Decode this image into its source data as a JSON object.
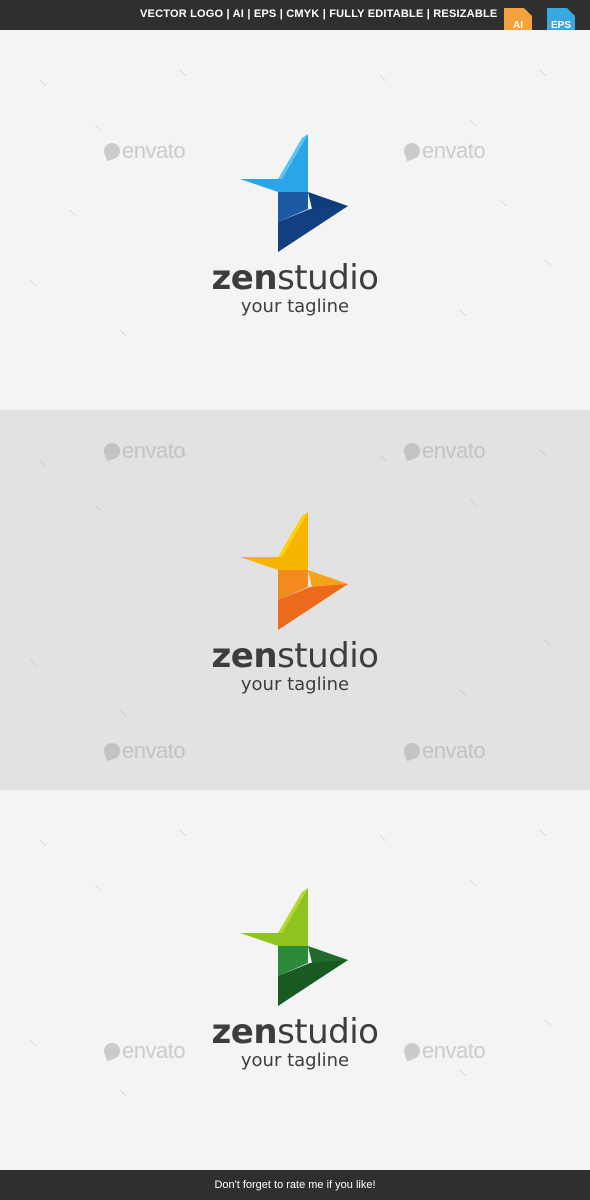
{
  "header": {
    "features": "VECTOR LOGO  |  AI  |  EPS  | CMYK  |  FULLY EDITABLE  |  RESIZABLE",
    "badges": {
      "ai": "AI",
      "eps": "EPS"
    },
    "badge_colors": {
      "ai": "#f4a23c",
      "eps": "#38a9e0"
    }
  },
  "watermark_text": "envato",
  "logos": [
    {
      "brand_bold": "zen",
      "brand_regular": "studio",
      "tagline": "your tagline",
      "colors": {
        "top": "#2aa6e8",
        "top_light": "#5cc3f2",
        "bottom": "#0d3c7a",
        "bottom_light": "#1d5aa6"
      }
    },
    {
      "brand_bold": "zen",
      "brand_regular": "studio",
      "tagline": "your tagline",
      "colors": {
        "top": "#f7b500",
        "top_light": "#fcd200",
        "bottom": "#ec6a1c",
        "bottom_light": "#f38a1d"
      }
    },
    {
      "brand_bold": "zen",
      "brand_regular": "studio",
      "tagline": "your tagline",
      "colors": {
        "top": "#8fc31f",
        "top_light": "#b6d72a",
        "bottom": "#1f6b2a",
        "bottom_light": "#2d8a3a"
      }
    }
  ],
  "footer": {
    "text": "Don't forget to rate me if you like!"
  }
}
